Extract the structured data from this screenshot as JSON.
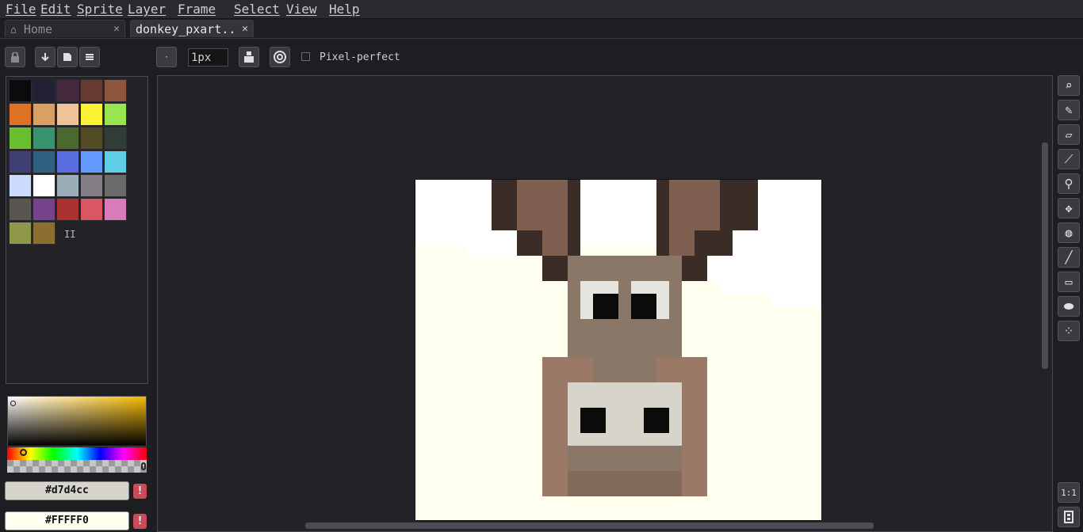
{
  "menu": [
    "File",
    "Edit",
    "Sprite",
    "Layer",
    "Frame",
    "Select",
    "View",
    "Help"
  ],
  "tabs": {
    "home": {
      "label": "Home",
      "icon": "home-icon"
    },
    "document": {
      "label": "donkey_pxart..",
      "icon": "close-icon"
    }
  },
  "toolbar": {
    "brush_size": "1px",
    "pixel_perfect_label": "Pixel-perfect",
    "pixel_perfect_checked": false
  },
  "palette": {
    "colors": [
      "#0b0b0d",
      "#222034",
      "#45283c",
      "#663931",
      "#8f563b",
      "#df7126",
      "#d9a066",
      "#eec39a",
      "#fbf236",
      "#99e550",
      "#6abe30",
      "#37946e",
      "#4b692f",
      "#524b24",
      "#323c39",
      "#3f3f74",
      "#306082",
      "#5b6ee1",
      "#639bff",
      "#5fcde4",
      "#cbdbfc",
      "#ffffff",
      "#9badb7",
      "#847e87",
      "#696a6a",
      "#595652",
      "#76428a",
      "#ac3232",
      "#d95763",
      "#d77bba",
      "#8f974a",
      "#8a6f30"
    ],
    "resize_handle": "II"
  },
  "colors": {
    "foreground_hex": "#d7d4cc",
    "background_hex": "#FFFFF0",
    "hue_base": "#f5b800"
  },
  "right_tools": [
    "lasso-select-icon",
    "pencil-icon",
    "eraser-icon",
    "eyedropper-icon",
    "zoom-icon",
    "move-icon",
    "paint-bucket-icon",
    "line-icon",
    "rectangle-icon",
    "ellipse-icon",
    "spray-icon"
  ],
  "bottom_tools": {
    "zoom_reset_label": "1:1",
    "timeline_icon": "film-icon"
  }
}
